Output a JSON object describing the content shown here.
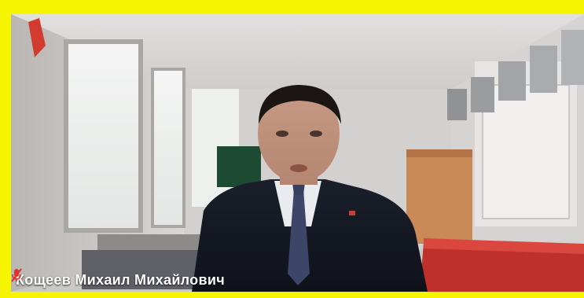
{
  "participant": {
    "name": "Кощеев  Михаил Михайлович",
    "mic_icon": "mic-muted-icon",
    "mic_color": "#e0322c"
  },
  "frame": {
    "border_color": "#f7f400"
  }
}
